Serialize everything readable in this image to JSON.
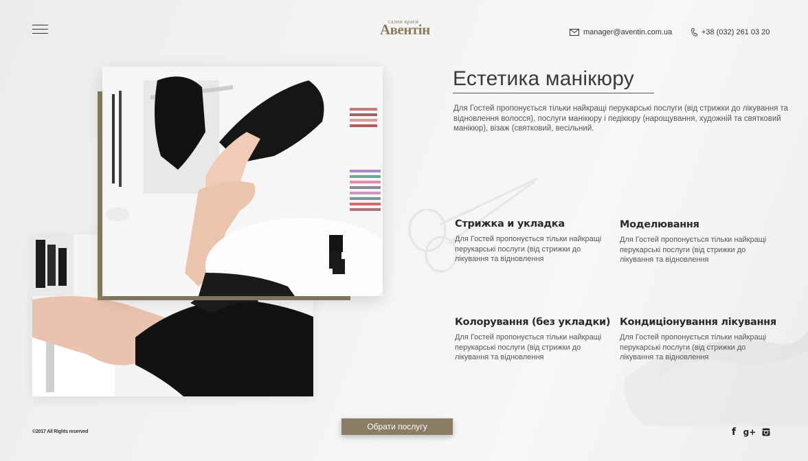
{
  "header": {
    "logo_small": "салон краси",
    "logo_main": "Авентін",
    "email": "manager@aventin.com.ua",
    "phone": "+38 (032) 261 03 20",
    "menu_icon": "hamburger-menu-icon",
    "email_icon": "envelope-icon",
    "phone_icon": "phone-icon"
  },
  "main": {
    "title": "Естетика манікюру",
    "intro": "Для Гостей пропонується тільки найкращі перукарські послуги (від стрижки до лікування та відновлення волосся), послуги манікюру і педікюру (нарощування, художній та святковий манікюр), візаж (святковий, весільний."
  },
  "services": [
    {
      "title": "Стрижка и укладка",
      "text": "Для Гостей пропонується тільки найкращі перукарські послуги (від стрижки до лікування та відновлення"
    },
    {
      "title": "Моделювання",
      "text": "Для Гостей пропонується тільки найкращі перукарські послуги (від стрижки до лікування та відновлення"
    },
    {
      "title": "Колорування (без укладки)",
      "text": "Для Гостей пропонується тільки найкращі перукарські послуги (від стрижки до лікування та відновлення"
    },
    {
      "title": "Кондиціонування лікування",
      "text": "Для Гостей пропонується тільки найкращі перукарські послуги (від стрижки до лікування та відновлення"
    }
  ],
  "cta": {
    "label": "Обрати послугу"
  },
  "footer": {
    "copyright": "©2017 All Rights reserved",
    "social": [
      {
        "icon": "facebook-icon",
        "glyph": "f"
      },
      {
        "icon": "google-plus-icon",
        "glyph": "g+"
      },
      {
        "icon": "instagram-icon"
      }
    ]
  },
  "colors": {
    "accent": "#8b7d63",
    "text": "#3a3a3a",
    "background": "#f2f2f2"
  }
}
